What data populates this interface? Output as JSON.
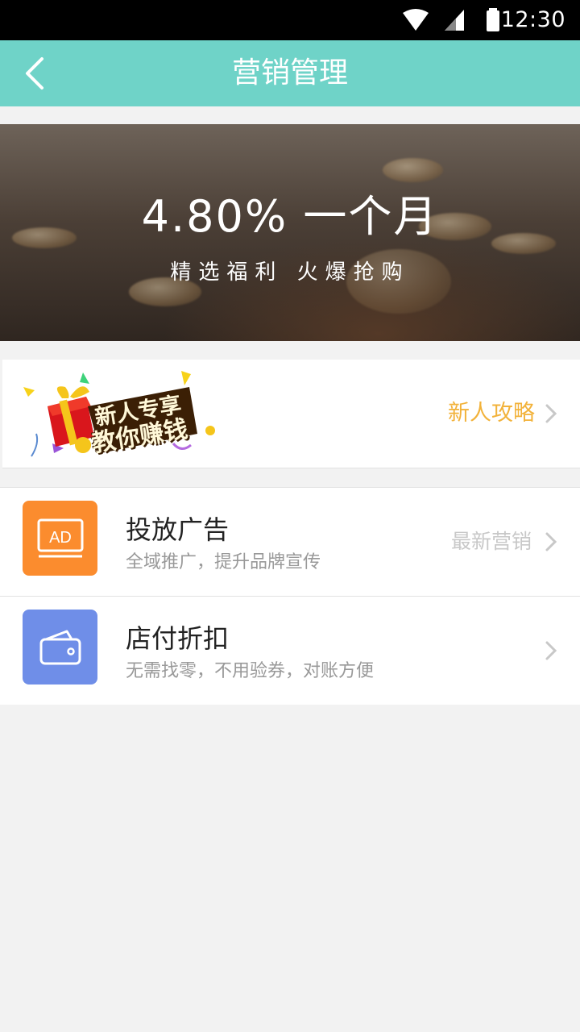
{
  "status_bar": {
    "time": "12:30"
  },
  "header": {
    "title": "营销管理"
  },
  "banner": {
    "headline": "4.80% 一个月",
    "subline": "精选福利 火爆抢购"
  },
  "promo": {
    "badge_line1": "新人专享",
    "badge_line2": "教你赚钱",
    "link_label": "新人攻略"
  },
  "list": {
    "items": [
      {
        "icon_label": "AD",
        "title": "投放广告",
        "subtitle": "全域推广，提升品牌宣传",
        "right_label": "最新营销"
      },
      {
        "title": "店付折扣",
        "subtitle": "无需找零，不用验券，对账方便"
      }
    ]
  },
  "colors": {
    "header_bg": "#6fd3c8",
    "promo_link": "#f2b23a",
    "ad_icon_bg": "#fb8c2e",
    "wallet_icon_bg": "#6f8ee8"
  }
}
